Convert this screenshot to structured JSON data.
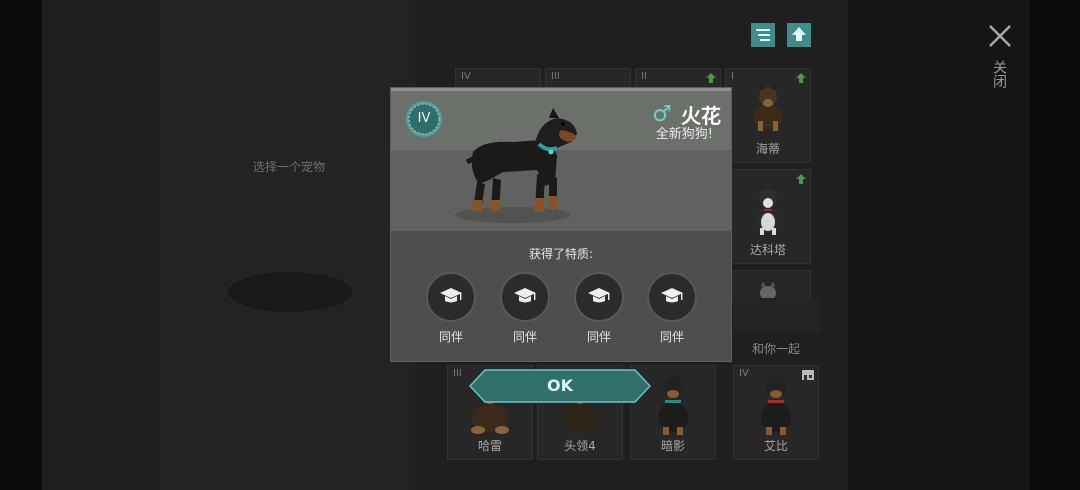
{
  "screen": {
    "choose_pet_hint": "选择一个宠物",
    "close_label": "关闭",
    "together_label": "和你一起"
  },
  "toolbar": {
    "icons": [
      "filter-list-icon",
      "upload-arrow-icon",
      "close-icon"
    ]
  },
  "pet_grid": {
    "top_row_tiers": [
      "IV",
      "III",
      "II",
      "I"
    ],
    "cards": [
      {
        "name": "海蒂",
        "breed": "german-shepherd"
      },
      {
        "name": "达科塔",
        "breed": "husky"
      }
    ],
    "bottom_cards": [
      {
        "tier": "III",
        "name": "哈雷"
      },
      {
        "tier": "",
        "name": "头领4"
      },
      {
        "tier": "",
        "name": "暗影"
      },
      {
        "tier": "IV",
        "name": "艾比"
      }
    ]
  },
  "modal": {
    "tier": "IV",
    "gender_symbol": "♂",
    "pet_name": "火花",
    "subtitle": "全新狗狗!",
    "traits_title": "获得了特质:",
    "traits": [
      {
        "icon": "graduation-cap-icon",
        "label": "同伴"
      },
      {
        "icon": "graduation-cap-icon",
        "label": "同伴"
      },
      {
        "icon": "graduation-cap-icon",
        "label": "同伴"
      },
      {
        "icon": "graduation-cap-icon",
        "label": "同伴"
      }
    ],
    "ok_label": "OK"
  },
  "colors": {
    "accent": "#3f8d8a",
    "gender": "#6fd1cc",
    "upgrade_arrow": "#4a9a3f"
  }
}
